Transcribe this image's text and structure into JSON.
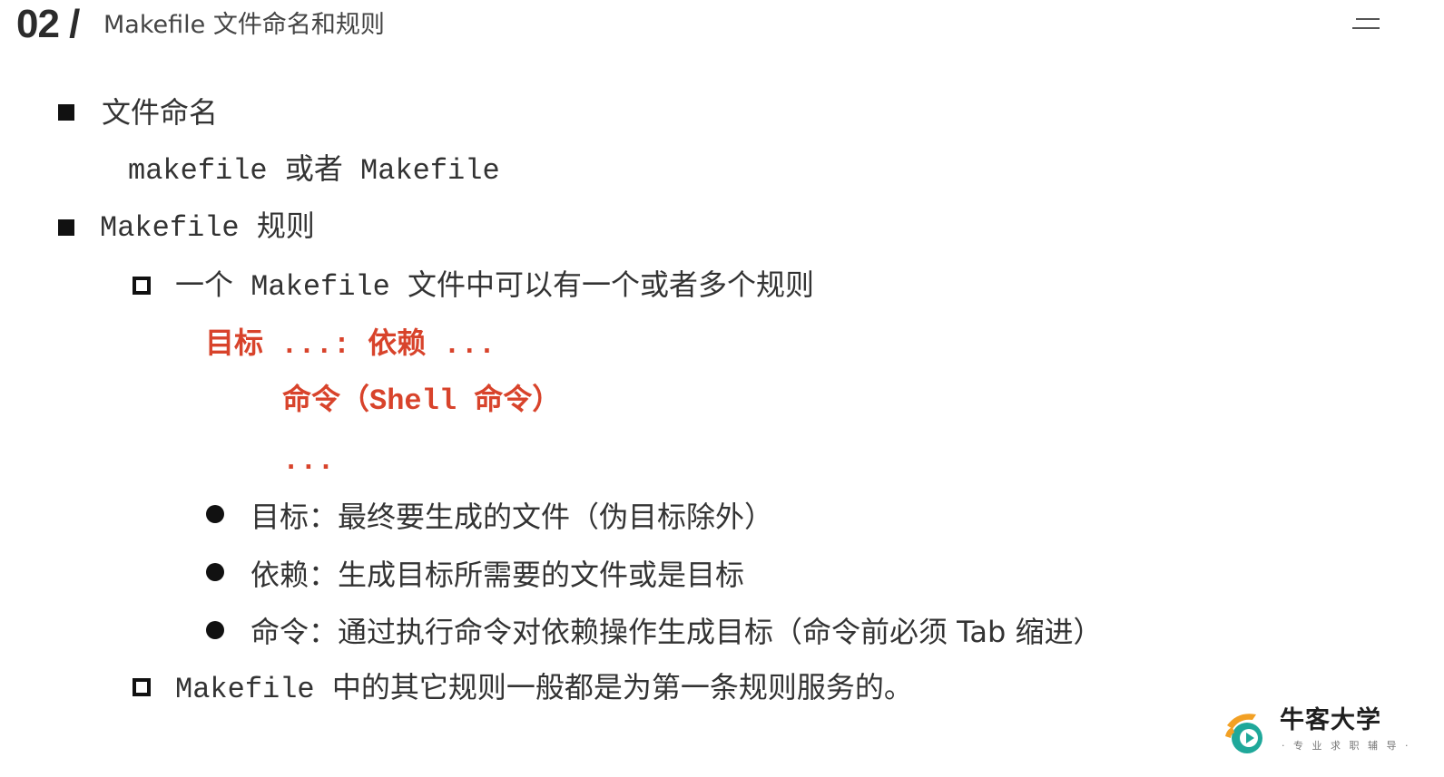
{
  "header": {
    "number": "02 /",
    "title": "Makefile 文件命名和规则"
  },
  "content": {
    "section1": {
      "title": "文件命名",
      "detail": "makefile 或者 Makefile"
    },
    "section2": {
      "title": "Makefile 规则",
      "sub1": "一个 Makefile 文件中可以有一个或者多个规则",
      "syntax": {
        "line1": "目标 ...: 依赖 ...",
        "line2": "命令（Shell 命令）",
        "line3": "..."
      },
      "bullets": [
        "目标：最终要生成的文件（伪目标除外）",
        "依赖：生成目标所需要的文件或是目标",
        "命令：通过执行命令对依赖操作生成目标（命令前必须 Tab 缩进）"
      ],
      "sub2": "Makefile 中的其它规则一般都是为第一条规则服务的。"
    }
  },
  "logo": {
    "name": "牛客大学",
    "tagline": "· 专 业 求 职 辅 导 ·",
    "colors": {
      "teal": "#1fa89a",
      "orange": "#f2a024"
    }
  },
  "colors": {
    "text": "#333333",
    "accent_red": "#d8432b",
    "bullet": "#111111"
  }
}
